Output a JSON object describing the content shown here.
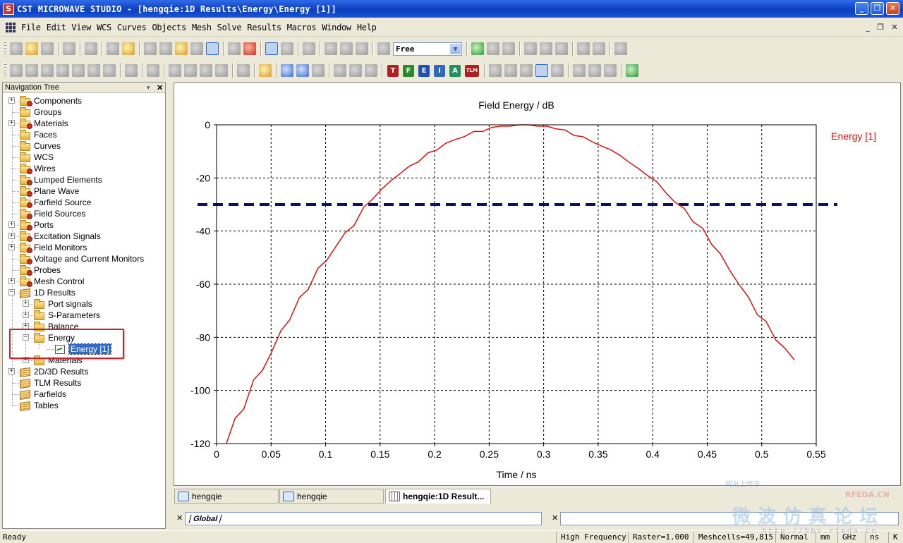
{
  "window": {
    "title": "CST MICROWAVE STUDIO - [hengqie:1D Results\\Energy\\Energy [1]]",
    "app_icon_letter": "S",
    "minimize": "_",
    "maximize": "❐",
    "close": "✕"
  },
  "menu": {
    "items": [
      "File",
      "Edit",
      "View",
      "WCS",
      "Curves",
      "Objects",
      "Mesh",
      "Solve",
      "Results",
      "Macros",
      "Window",
      "Help"
    ],
    "mdi_minimize": "_",
    "mdi_restore": "❐",
    "mdi_close": "✕"
  },
  "toolbar": {
    "mode_select_value": "Free",
    "letter_buttons": [
      {
        "label": "T",
        "color": "#b02020"
      },
      {
        "label": "F",
        "color": "#2a8a2a"
      },
      {
        "label": "E",
        "color": "#2050b0"
      },
      {
        "label": "I",
        "color": "#2a6ac0"
      },
      {
        "label": "A",
        "color": "#209060"
      },
      {
        "label": "TLM",
        "color": "#b02020"
      }
    ]
  },
  "navigation_tree": {
    "title": "Navigation Tree",
    "pin": "▾",
    "close": "✕",
    "items": [
      {
        "label": "Components",
        "expander": "+",
        "icon": "gear-folder"
      },
      {
        "label": "Groups",
        "expander": "",
        "icon": "folder"
      },
      {
        "label": "Materials",
        "expander": "+",
        "icon": "gear-folder"
      },
      {
        "label": "Faces",
        "expander": "",
        "icon": "folder"
      },
      {
        "label": "Curves",
        "expander": "",
        "icon": "folder"
      },
      {
        "label": "WCS",
        "expander": "",
        "icon": "folder"
      },
      {
        "label": "Wires",
        "expander": "",
        "icon": "gear-folder"
      },
      {
        "label": "Lumped Elements",
        "expander": "",
        "icon": "gear-folder"
      },
      {
        "label": "Plane Wave",
        "expander": "",
        "icon": "gear-folder"
      },
      {
        "label": "Farfield Source",
        "expander": "",
        "icon": "gear-folder"
      },
      {
        "label": "Field Sources",
        "expander": "",
        "icon": "gear-folder"
      },
      {
        "label": "Ports",
        "expander": "+",
        "icon": "gear-folder"
      },
      {
        "label": "Excitation Signals",
        "expander": "+",
        "icon": "gear-folder"
      },
      {
        "label": "Field Monitors",
        "expander": "+",
        "icon": "gear-folder"
      },
      {
        "label": "Voltage and Current Monitors",
        "expander": "",
        "icon": "gear-folder"
      },
      {
        "label": "Probes",
        "expander": "",
        "icon": "gear-folder"
      },
      {
        "label": "Mesh Control",
        "expander": "+",
        "icon": "gear-folder"
      },
      {
        "label": "1D Results",
        "expander": "−",
        "icon": "stack"
      },
      {
        "label": "Port signals",
        "expander": "+",
        "icon": "folder",
        "indent": 1
      },
      {
        "label": "S-Parameters",
        "expander": "+",
        "icon": "folder",
        "indent": 1
      },
      {
        "label": "Balance",
        "expander": "+",
        "icon": "folder",
        "indent": 1
      },
      {
        "label": "Energy",
        "expander": "−",
        "icon": "folder",
        "indent": 1
      },
      {
        "label": "Energy [1]",
        "expander": "",
        "icon": "chart",
        "indent": 2,
        "selected": true
      },
      {
        "label": "Materials",
        "expander": "+",
        "icon": "folder",
        "indent": 1
      },
      {
        "label": "2D/3D Results",
        "expander": "+",
        "icon": "stack"
      },
      {
        "label": "TLM Results",
        "expander": "",
        "icon": "stack"
      },
      {
        "label": "Farfields",
        "expander": "",
        "icon": "stack"
      },
      {
        "label": "Tables",
        "expander": "",
        "icon": "stack"
      }
    ]
  },
  "chart_data": {
    "type": "line",
    "title": "Field Energy / dB",
    "xlabel": "Time / ns",
    "ylabel": "",
    "xlim": [
      0,
      0.55
    ],
    "ylim": [
      -120,
      0
    ],
    "xticks": [
      "0",
      "0.05",
      "0.1",
      "0.15",
      "0.2",
      "0.25",
      "0.3",
      "0.35",
      "0.4",
      "0.45",
      "0.5",
      "0.55"
    ],
    "yticks": [
      "0",
      "-20",
      "-40",
      "-60",
      "-80",
      "-100",
      "-120"
    ],
    "grid": true,
    "legend": "top-right",
    "series": [
      {
        "name": "Energy [1]",
        "color": "#e01010",
        "x": [
          0.009,
          0.017,
          0.025,
          0.034,
          0.042,
          0.05,
          0.059,
          0.067,
          0.076,
          0.084,
          0.093,
          0.101,
          0.11,
          0.118,
          0.126,
          0.135,
          0.143,
          0.152,
          0.16,
          0.168,
          0.177,
          0.185,
          0.194,
          0.202,
          0.21,
          0.219,
          0.227,
          0.236,
          0.244,
          0.252,
          0.261,
          0.269,
          0.278,
          0.286,
          0.294,
          0.303,
          0.311,
          0.32,
          0.328,
          0.336,
          0.345,
          0.353,
          0.362,
          0.37,
          0.378,
          0.387,
          0.395,
          0.404,
          0.412,
          0.42,
          0.429,
          0.437,
          0.446,
          0.454,
          0.462,
          0.471,
          0.479,
          0.488,
          0.496,
          0.504,
          0.513,
          0.521,
          0.53
        ],
        "y": [
          -120,
          -110.5,
          -107,
          -96,
          -92.5,
          -86,
          -77.5,
          -73.5,
          -65,
          -62,
          -54,
          -51,
          -45.5,
          -40.5,
          -38,
          -31,
          -28,
          -24,
          -21,
          -18.5,
          -15.5,
          -14,
          -10.5,
          -9.5,
          -7,
          -5.5,
          -4.5,
          -2.5,
          -2.5,
          -1,
          -0.5,
          -0.5,
          0,
          0,
          -0.5,
          -0.5,
          -1.5,
          -2,
          -4,
          -4.5,
          -6.5,
          -8,
          -9.5,
          -11.5,
          -14,
          -16.5,
          -19,
          -21.5,
          -25.5,
          -29,
          -31.5,
          -36.5,
          -39,
          -45,
          -48.5,
          -55,
          -60,
          -65,
          -71.5,
          -74,
          -81,
          -84,
          -88.5
        ]
      }
    ],
    "reference_line": {
      "y": -30,
      "style": "dashed",
      "color": "#101060"
    }
  },
  "tabs": [
    {
      "label": "hengqie",
      "icon": "3d-view-icon",
      "active": false
    },
    {
      "label": "hengqie",
      "icon": "schematic-icon",
      "active": false
    },
    {
      "label": "hengqie:1D Result...",
      "icon": "grid-icon",
      "active": true
    }
  ],
  "bottom": {
    "global_tab": "Global",
    "close": "✕"
  },
  "statusbar": {
    "ready": "Ready",
    "fields": [
      "High Frequency",
      "Raster=1.000",
      "Meshcells=49,815",
      "Normal",
      "mm",
      "GHz",
      "ns",
      "K"
    ]
  },
  "watermark": {
    "line1": "网友上传于",
    "brand": "RFEDA.CN",
    "main": "微波仿真论坛",
    "url": "http://bbs.rfeda.cn"
  }
}
